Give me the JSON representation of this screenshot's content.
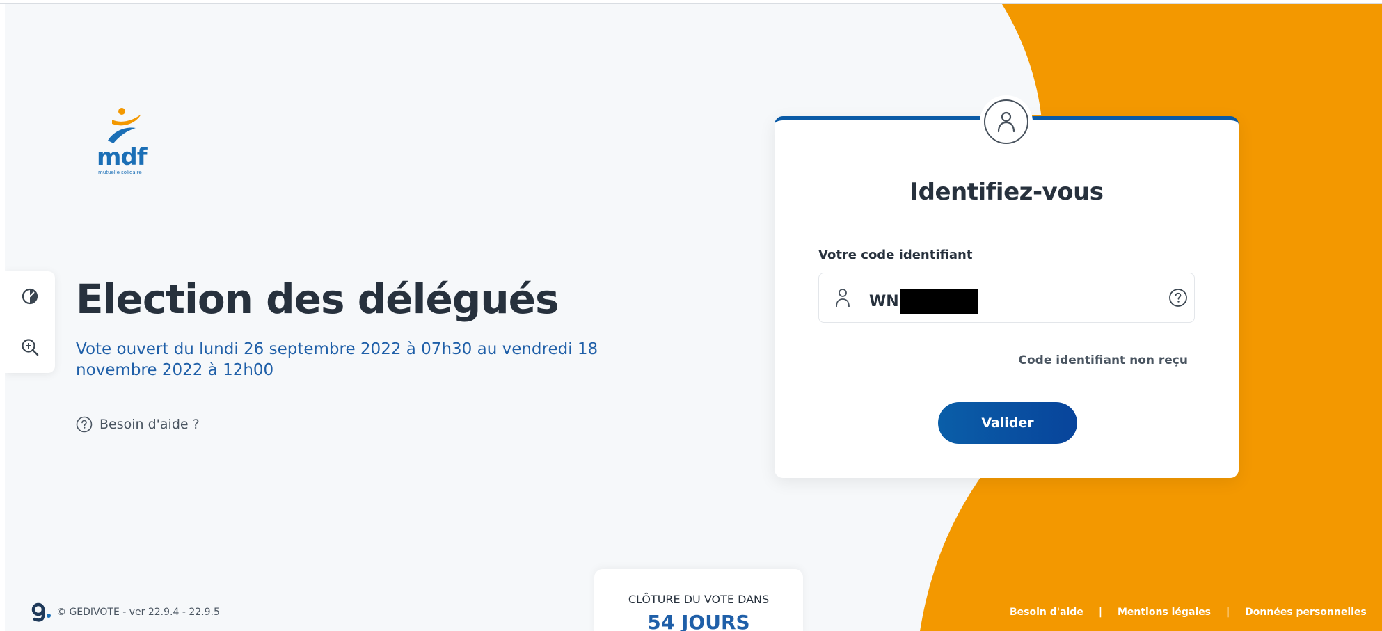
{
  "logo": {
    "name": "mdf",
    "tagline": "mutuelle solidaire"
  },
  "accessibility": {
    "contrast_icon": "contrast-icon",
    "zoom_icon": "zoom-in-icon"
  },
  "main": {
    "title": "Election des délégués",
    "vote_period": "Vote ouvert du lundi 26 septembre 2022 à 07h30 au vendredi 18 novembre 2022 à 12h00",
    "help_link": "Besoin d'aide ?"
  },
  "login": {
    "title": "Identifiez-vous",
    "field_label": "Votre code identifiant",
    "field_value": "WN",
    "code_link": "Code identifiant non reçu",
    "submit_label": "Valider"
  },
  "countdown": {
    "label": "CLÔTURE DU VOTE DANS",
    "value": "54 JOURS"
  },
  "footer": {
    "copyright": "© GEDIVOTE - ver 22.9.4 - 22.9.5",
    "links": [
      "Besoin d'aide",
      "Mentions légales",
      "Données personnelles"
    ],
    "separator": "|"
  },
  "colors": {
    "accent_orange": "#f39800",
    "primary_blue": "#0a5aa6",
    "text_dark": "#27313d",
    "link_blue": "#1f5fa8",
    "background": "#f6f8fa"
  }
}
